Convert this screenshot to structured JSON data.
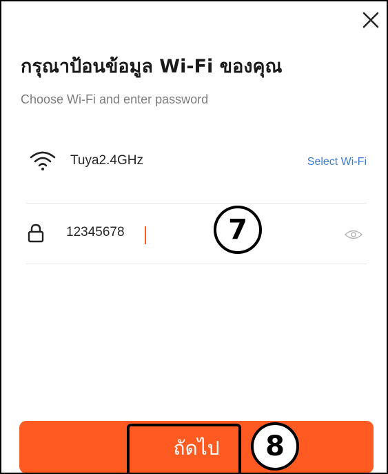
{
  "header": {
    "title": "กรุณาป้อนข้อมูล Wi-Fi ของคุณ",
    "subtitle": "Choose Wi-Fi and enter password",
    "close_icon": "close-icon"
  },
  "wifi": {
    "icon": "wifi-icon",
    "ssid": "Tuya2.4GHz",
    "select_label": "Select Wi-Fi"
  },
  "password": {
    "icon": "lock-icon",
    "value": "12345678",
    "visibility_icon": "eye-icon"
  },
  "annotations": {
    "step_password": "7",
    "step_next": "8"
  },
  "footer": {
    "next_label": "ถัดไป"
  },
  "colors": {
    "accent": "#ff5a22",
    "link": "#3a7bd5",
    "caret": "#ff5a1f"
  }
}
